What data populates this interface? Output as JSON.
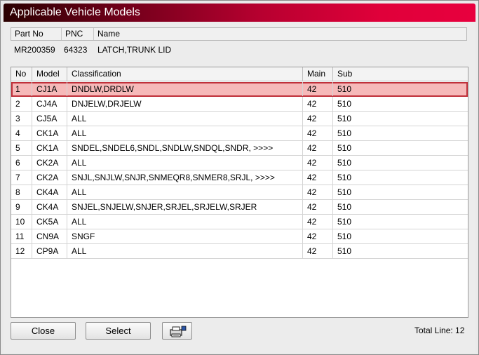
{
  "window": {
    "title": "Applicable Vehicle Models"
  },
  "part_info": {
    "headers": [
      "Part No",
      "PNC",
      "Name"
    ],
    "part_no": "MR200359",
    "pnc": "64323",
    "name": "LATCH,TRUNK LID"
  },
  "grid": {
    "columns": [
      "No",
      "Model",
      "Classification",
      "Main",
      "Sub"
    ],
    "rows": [
      {
        "no": "1",
        "model": "CJ1A",
        "classification": "DNDLW,DRDLW",
        "main": "42",
        "sub": "510"
      },
      {
        "no": "2",
        "model": "CJ4A",
        "classification": "DNJELW,DRJELW",
        "main": "42",
        "sub": "510"
      },
      {
        "no": "3",
        "model": "CJ5A",
        "classification": "ALL",
        "main": "42",
        "sub": "510"
      },
      {
        "no": "4",
        "model": "CK1A",
        "classification": "ALL",
        "main": "42",
        "sub": "510"
      },
      {
        "no": "5",
        "model": "CK1A",
        "classification": "SNDEL,SNDEL6,SNDL,SNDLW,SNDQL,SNDR,  >>>>",
        "main": "42",
        "sub": "510"
      },
      {
        "no": "6",
        "model": "CK2A",
        "classification": "ALL",
        "main": "42",
        "sub": "510"
      },
      {
        "no": "7",
        "model": "CK2A",
        "classification": "SNJL,SNJLW,SNJR,SNMEQR8,SNMER8,SRJL,  >>>>",
        "main": "42",
        "sub": "510"
      },
      {
        "no": "8",
        "model": "CK4A",
        "classification": "ALL",
        "main": "42",
        "sub": "510"
      },
      {
        "no": "9",
        "model": "CK4A",
        "classification": "SNJEL,SNJELW,SNJER,SRJEL,SRJELW,SRJER",
        "main": "42",
        "sub": "510"
      },
      {
        "no": "10",
        "model": "CK5A",
        "classification": "ALL",
        "main": "42",
        "sub": "510"
      },
      {
        "no": "11",
        "model": "CN9A",
        "classification": "SNGF",
        "main": "42",
        "sub": "510"
      },
      {
        "no": "12",
        "model": "CP9A",
        "classification": "ALL",
        "main": "42",
        "sub": "510"
      }
    ],
    "selected_row": 1
  },
  "footer": {
    "close_label": "Close",
    "select_label": "Select",
    "print_icon": "printer-icon",
    "total_line": "Total Line: 12"
  },
  "colors": {
    "title_gradient_end": "#e8003e",
    "selected_row_bg": "#f6b9b9",
    "selected_row_border": "#c0303a"
  }
}
